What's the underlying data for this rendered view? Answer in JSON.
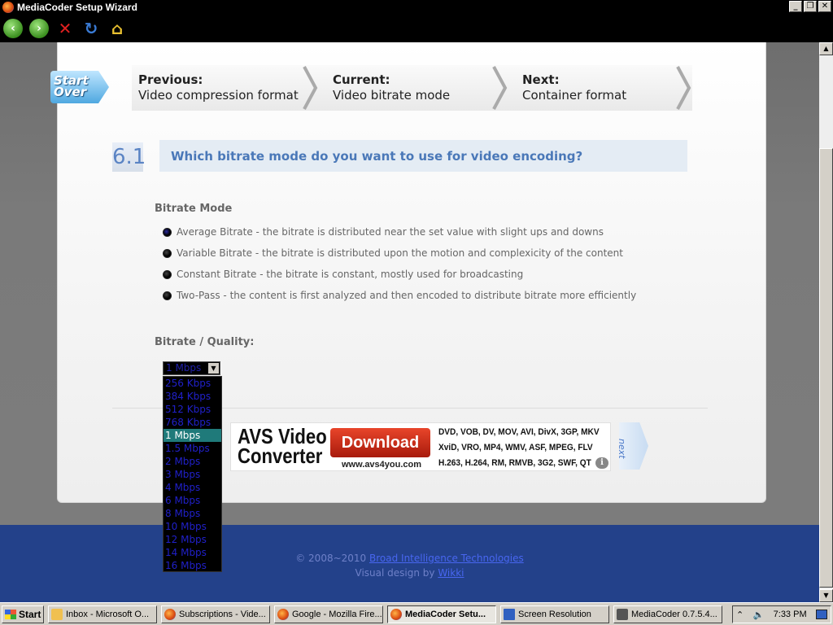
{
  "window": {
    "title": "MediaCoder Setup Wizard"
  },
  "nav": {
    "start_over": "Start Over",
    "previous": {
      "label": "Previous:",
      "value": "Video compression format"
    },
    "current": {
      "label": "Current:",
      "value": "Video bitrate mode"
    },
    "next": {
      "label": "Next:",
      "value": "Container format"
    }
  },
  "question": {
    "number": "6.1",
    "text": "Which bitrate mode do you want to use for video encoding?"
  },
  "bitrate_mode": {
    "title": "Bitrate Mode",
    "options": [
      {
        "label": "Average Bitrate - the bitrate is distributed near the set value with slight ups and downs",
        "selected": true
      },
      {
        "label": "Variable Bitrate - the bitrate is distributed upon the motion and complexicity of the content",
        "selected": false
      },
      {
        "label": "Constant Bitrate - the bitrate is constant, mostly used for broadcasting",
        "selected": false
      },
      {
        "label": "Two-Pass - the content is first analyzed and then encoded to distribute bitrate more efficiently",
        "selected": false
      }
    ]
  },
  "bitrate_quality": {
    "title": "Bitrate / Quality:",
    "selected": "1 Mbps",
    "options": [
      "256 Kbps",
      "384 Kbps",
      "512 Kbps",
      "768 Kbps",
      "1 Mbps",
      "1.5 Mbps",
      "2 Mbps",
      "3 Mbps",
      "4 Mbps",
      "6 Mbps",
      "8 Mbps",
      "10 Mbps",
      "12 Mbps",
      "14 Mbps",
      "16 Mbps"
    ]
  },
  "ad": {
    "title_line1": "AVS Video",
    "title_line2": "Converter",
    "download": "Download",
    "url": "www.avs4you.com",
    "formats_line1": "DVD, VOB, DV, MOV, AVI, DivX, 3GP, MKV",
    "formats_line2": "XviD, VRO, MP4, WMV, ASF, MPEG, FLV",
    "formats_line3": "H.263, H.264, RM, RMVB, 3G2, SWF, QT",
    "info": "i"
  },
  "next_button": "next",
  "footer": {
    "copyright_prefix": "© 2008~2010 ",
    "company": "Broad Intelligence Technologies",
    "design_prefix": "Visual design by ",
    "designer": "Wikki"
  },
  "taskbar": {
    "start": "Start",
    "tasks": [
      {
        "label": "Inbox - Microsoft O...",
        "icon": "mail-icon"
      },
      {
        "label": "Subscriptions - Vide...",
        "icon": "firefox-icon"
      },
      {
        "label": "Google - Mozilla Fire...",
        "icon": "firefox-icon"
      },
      {
        "label": "MediaCoder Setu...",
        "icon": "firefox-icon",
        "active": true
      },
      {
        "label": "Screen Resolution",
        "icon": "display-icon"
      },
      {
        "label": "MediaCoder 0.7.5.4...",
        "icon": "mediacoder-icon"
      }
    ],
    "clock": "7:33 PM"
  }
}
